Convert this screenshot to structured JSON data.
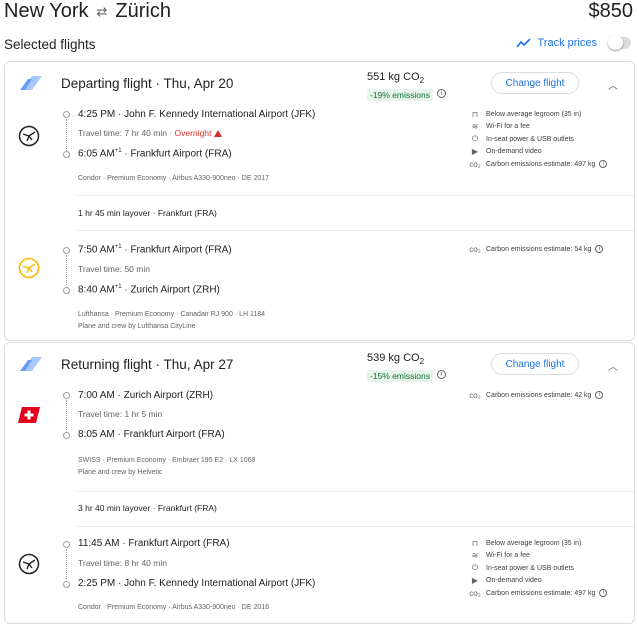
{
  "header": {
    "origin": "New York",
    "swap_icon": "swap-arrows-icon",
    "destination": "Zürich",
    "price": "$850"
  },
  "selected_title": "Selected flights",
  "track": {
    "label": "Track prices",
    "on": false
  },
  "departing": {
    "title": "Departing flight · Thu, Apr 20",
    "co2": "551 kg CO",
    "co2_sub": "2",
    "emissions_badge": "-19% emissions",
    "change_label": "Change flight",
    "segments": [
      {
        "airline_icon": "condor-logo",
        "dep_time": "4:25 PM",
        "dep_sup": "",
        "dep_airport": "John F. Kennedy International Airport (JFK)",
        "travel_time": "Travel time: 7 hr 40 min",
        "overnight": "Overnight",
        "arr_time": "6:05 AM",
        "arr_sup": "+1",
        "arr_airport": "Frankfurt Airport (FRA)",
        "meta": "Condor · Premium Economy · Airbus A330-900neo · DE 2017",
        "meta2": "",
        "amenities": [
          "Below average legroom (35 in)",
          "Wi-Fi for a fee",
          "In-seat power & USB outlets",
          "On-demand video",
          "Carbon emissions estimate: 497 kg"
        ]
      },
      {
        "airline_icon": "lufthansa-logo",
        "dep_time": "7:50 AM",
        "dep_sup": "+1",
        "dep_airport": "Frankfurt Airport (FRA)",
        "travel_time": "Travel time: 50 min",
        "overnight": "",
        "arr_time": "8:40 AM",
        "arr_sup": "+1",
        "arr_airport": "Zurich Airport (ZRH)",
        "meta": "Lufthansa · Premium Economy · Canadair RJ 900 · LH 1184",
        "meta2": "Plane and crew by Lufthansa CityLine",
        "amenities": [
          "Carbon emissions estimate: 54 kg"
        ]
      }
    ],
    "layover": "1 hr 45 min layover · Frankfurt (FRA)"
  },
  "returning": {
    "title": "Returning flight · Thu, Apr 27",
    "co2": "539 kg CO",
    "co2_sub": "2",
    "emissions_badge": "-15% emissions",
    "change_label": "Change flight",
    "segments": [
      {
        "airline_icon": "swiss-logo",
        "dep_time": "7:00 AM",
        "dep_sup": "",
        "dep_airport": "Zurich Airport (ZRH)",
        "travel_time": "Travel time: 1 hr 5 min",
        "overnight": "",
        "arr_time": "8:05 AM",
        "arr_sup": "",
        "arr_airport": "Frankfurt Airport (FRA)",
        "meta": "SWISS · Premium Economy · Embraer 195 E2 · LX 1068",
        "meta2": "Plane and crew by Helvetic",
        "amenities": [
          "Carbon emissions estimate: 42 kg"
        ]
      },
      {
        "airline_icon": "condor-logo",
        "dep_time": "11:45 AM",
        "dep_sup": "",
        "dep_airport": "Frankfurt Airport (FRA)",
        "travel_time": "Travel time: 8 hr 40 min",
        "overnight": "",
        "arr_time": "2:25 PM",
        "arr_sup": "",
        "arr_airport": "John F. Kennedy International Airport (JFK)",
        "meta": "Condor · Premium Economy · Airbus A330-900neo · DE 2016",
        "meta2": "",
        "amenities": [
          "Below average legroom (35 in)",
          "Wi-Fi for a fee",
          "In-seat power & USB outlets",
          "On-demand video",
          "Carbon emissions estimate: 497 kg"
        ]
      }
    ],
    "layover": "3 hr 40 min layover · Frankfurt (FRA)"
  },
  "colors": {
    "accent": "#1a73e8",
    "green": "#137333",
    "warning": "#d93025",
    "lufthansa": "#f9ba00",
    "swiss": "#e2001a"
  }
}
